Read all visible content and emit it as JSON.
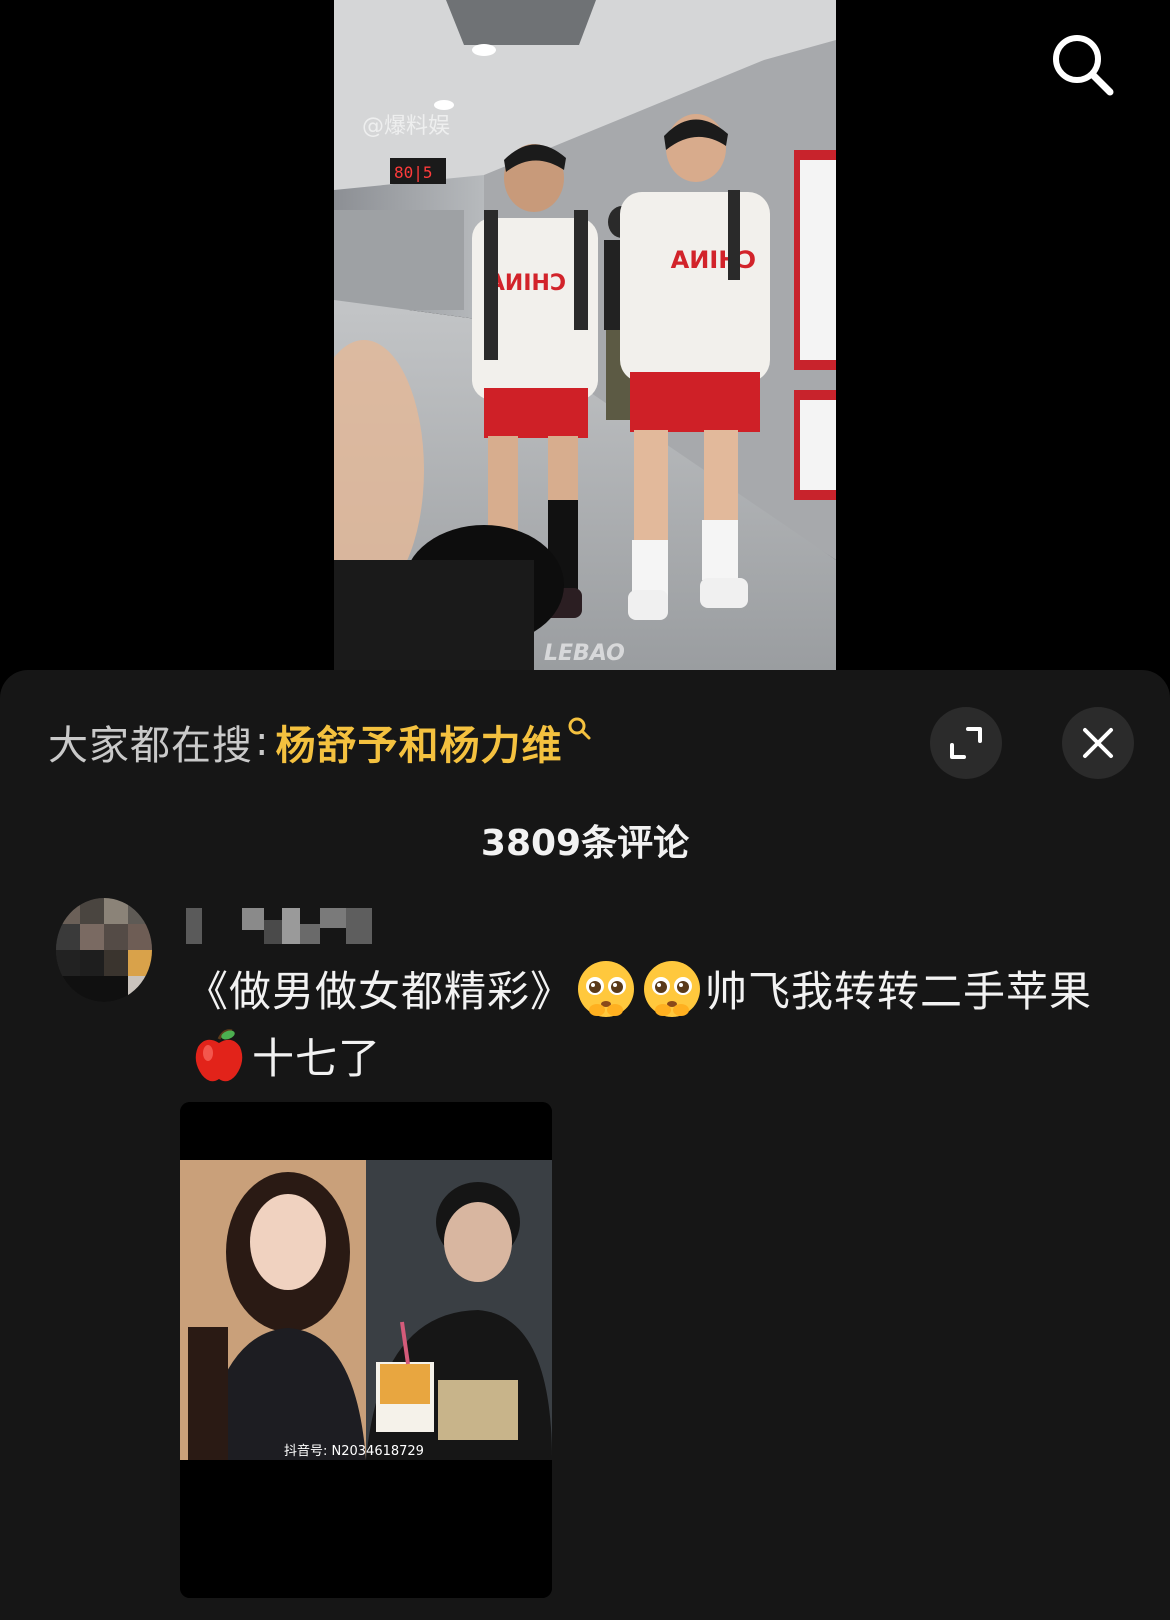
{
  "video": {
    "watermark_top": "@爆料娱",
    "watermark_bottom": "LEBAO",
    "jersey_text": "CHINA"
  },
  "top_actions": {
    "search_icon": "search-icon"
  },
  "suggestion": {
    "prefix": "大家都在搜",
    "separator": ":",
    "term": "杨舒予和杨力维",
    "term_color": "#f4c13f"
  },
  "sheet_actions": {
    "expand_icon": "expand-icon",
    "close_icon": "close-icon"
  },
  "comments_header": {
    "count_label": "3809条评论"
  },
  "comment": {
    "text_part1": "《做男做女都精彩》",
    "emojis": [
      "pleading-face",
      "pleading-face"
    ],
    "text_part2": "帅飞我转转二手苹果",
    "apple_emoji": "red-apple",
    "text_part3": "十七了",
    "image": {
      "watermark": "抖音号: N2034618729"
    }
  }
}
